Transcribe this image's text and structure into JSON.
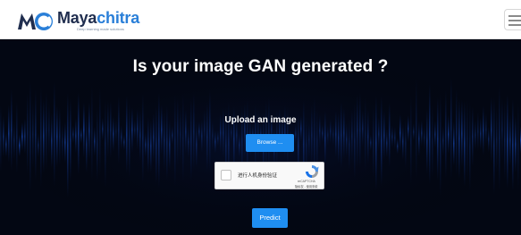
{
  "brand": {
    "name_part1": "Maya",
    "name_part2": "chitra",
    "tagline": "Deep learning made solutions",
    "logo_icon": "mc-logo-icon",
    "colors": {
      "dark": "#1f2d4e",
      "accent": "#2a7fd8"
    }
  },
  "nav": {
    "menu_icon": "hamburger-menu-icon"
  },
  "hero": {
    "title": "Is your image GAN generated ?",
    "upload_label": "Upload an image",
    "browse_label": "Browse ...",
    "predict_label": "Predict",
    "background_color": "#030713",
    "button_color": "#1f8ef1"
  },
  "captcha": {
    "label": "进行人机身份验证",
    "brand": "reCAPTCHA",
    "terms": "隐私权 - 使用条款",
    "icon": "recaptcha-icon"
  }
}
